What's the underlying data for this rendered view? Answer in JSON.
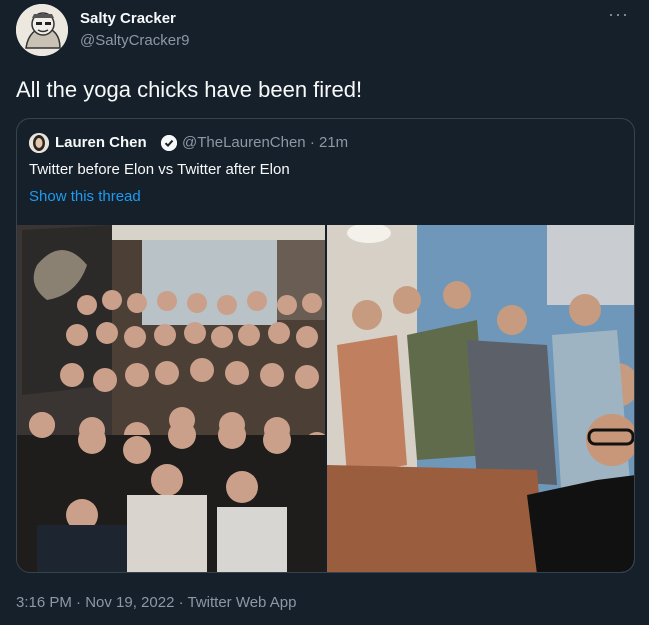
{
  "tweet": {
    "author_name": "Salty Cracker",
    "author_handle": "@SaltyCracker9",
    "more_icon": "ellipsis-icon",
    "text": "All the yoga chicks have been fired!",
    "footer": "3:16 PM · Nov 19, 2022 · Twitter Web App"
  },
  "quoted_tweet": {
    "author_name": "Lauren Chen",
    "author_handle": "@TheLaurenChen",
    "time": "· 21m",
    "text": "Twitter before Elon vs Twitter after Elon",
    "thread_link": "Show this thread",
    "verified_icon": "verified-badge-icon"
  },
  "colors": {
    "background": "#15202b",
    "text": "#f7f9f9",
    "secondary_text": "#8b98a5",
    "link": "#1d9bf0",
    "border": "#38444d"
  }
}
